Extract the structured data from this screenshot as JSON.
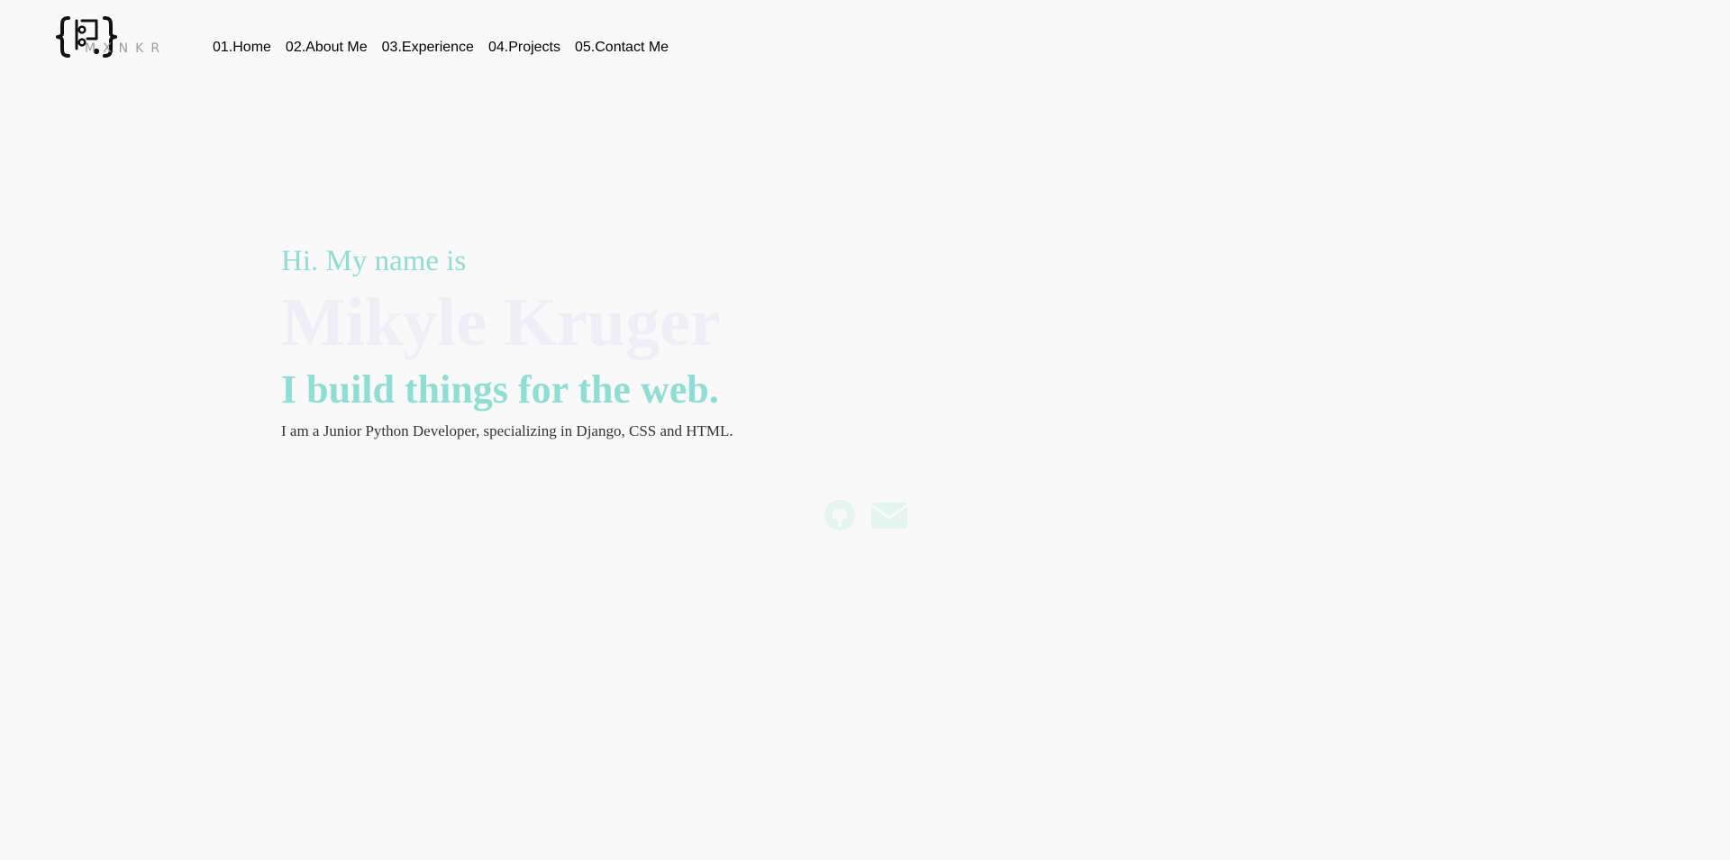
{
  "header": {
    "logo_text": "MXNKR",
    "nav": [
      {
        "label": "01.Home"
      },
      {
        "label": "02.About Me"
      },
      {
        "label": "03.Experience"
      },
      {
        "label": "04.Projects"
      },
      {
        "label": "05.Contact Me"
      }
    ]
  },
  "hero": {
    "greeting": "Hi. My name is",
    "name": "Mikyle Kruger",
    "tagline": "I build things for the web.",
    "description": "I am a Junior Python Developer, specializing in Django, CSS and HTML."
  },
  "socials": {
    "icons": [
      {
        "name": "github-icon",
        "label": "GitHub"
      },
      {
        "name": "email-icon",
        "label": "Email"
      }
    ]
  },
  "colors": {
    "background": "#f9f9f9",
    "accent": "#8fded3",
    "name_text": "#efedf6",
    "icon": "#e4f4f1",
    "nav_text": "#000000"
  }
}
